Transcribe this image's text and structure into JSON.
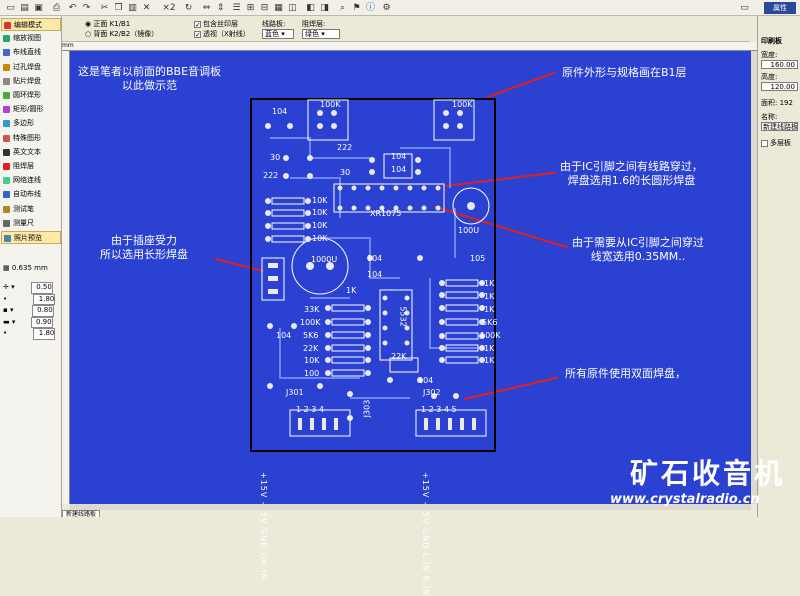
{
  "toolbar": {
    "zoom_label": "×2"
  },
  "options": {
    "front": "正面  K1/B1",
    "back": "背面  K2/B2（镜像）",
    "include_silk": "包含丝印层",
    "transparent": "透视（X射线）",
    "trace_label": "线路板:",
    "trace_color": "蓝色",
    "solder_label": "阻焊层:",
    "solder_color": "绿色"
  },
  "left_tools": [
    "编辑模式",
    "缩放视图",
    "布线直线",
    "过孔焊盘",
    "贴片焊盘",
    "圆环焊形",
    "矩形/圆形",
    "多边形",
    "特殊图形",
    "英文文本",
    "阻焊层",
    "网络连线",
    "自动布线",
    "测试笔",
    "测量尺",
    "照片预览"
  ],
  "grid": {
    "value": "0.635 mm"
  },
  "values": [
    "0.50",
    "1.80",
    "0.80",
    "0.90",
    "1.80"
  ],
  "right_panel": {
    "header": "属性",
    "section": "印刷板",
    "width_label": "宽度:",
    "width_value": "160.00",
    "height_label": "高度:",
    "height_value": "120.00",
    "area_label": "面积:",
    "area_value": "192",
    "name_label": "名称:",
    "name_value": "新建线路板",
    "multilayer": "多层板"
  },
  "ruler": {
    "unit": "mm"
  },
  "annotations": {
    "top_left": "这是笔者以前面的BBE音调板\n以此做示范",
    "top_right": "原件外形与规格画在B1层",
    "ic_pins": "由于IC引脚之间有线路穿过，\n焊盘选用1.6的长圆形焊盘",
    "trace_width": "由于需要从IC引脚之间穿过\n线宽选用0.35MM..",
    "socket": "由于插座受力\n所以选用长形焊盘",
    "double_sided": "所有原件使用双面焊盘，"
  },
  "pcb_labels": {
    "r104_top": "104",
    "pot100k_a": "100K",
    "pot100k_b": "100K",
    "c30": "30",
    "c222a": "222",
    "c222b": "222",
    "c30b": "30",
    "c104a": "104",
    "c104b": "104",
    "k10_1": "10K",
    "k10_2": "10K",
    "k10_3": "10K",
    "k10_4": "10K",
    "ic": "XR1075",
    "cap100u": "100U",
    "cap1000u": "1000U",
    "c104c": "104",
    "c104d": "104",
    "c105": "105",
    "k1a": "1K",
    "r1k_1": "1K",
    "r1k_2": "1K",
    "r1k_3": "1K",
    "r5k6": "5K6",
    "r100k": "100K",
    "r1k_4": "1K",
    "r1k_5": "1K",
    "r33k": "33K",
    "r100k_b": "100K",
    "r5k6_b": "5K6",
    "r22k": "22K",
    "r10k": "10K",
    "r100": "100",
    "opamp": "5532",
    "r22k_b": "22K",
    "c104e": "104",
    "c104f": "104",
    "j301": "J301",
    "j302": "J302",
    "j303": "J303",
    "j301_pins": "1 2 3 4",
    "j302_pins": "1 2 3 4 5",
    "j301_names": "+15V -15V GND OK IN",
    "j302_names": "+15V -15V GND L IN R IN"
  },
  "tab": {
    "label": "新建线路板"
  },
  "watermark": {
    "cn": "矿石收音机",
    "url": "www.crystalradio.cn"
  }
}
